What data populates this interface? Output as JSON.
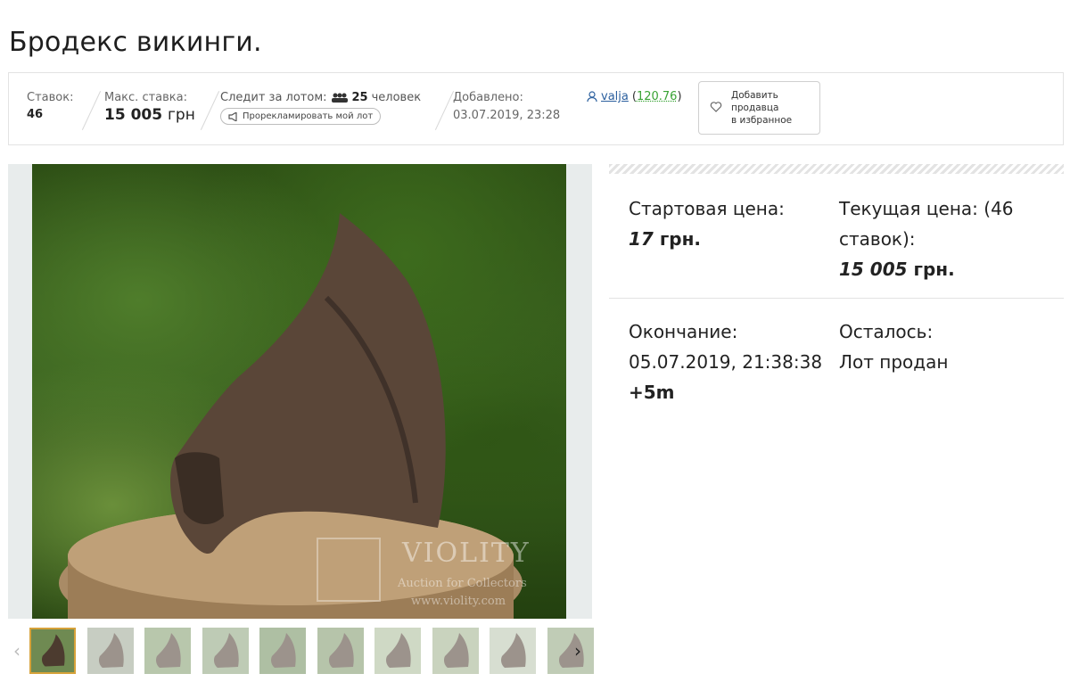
{
  "title": "Бродекс викинги.",
  "stats": {
    "bids_label": "Ставок:",
    "bids_value": "46",
    "max_bid_label": "Макс. ставка:",
    "max_bid_value": "15 005",
    "max_bid_unit": "грн",
    "watch_label": "Следит за лотом:",
    "watch_count": "25",
    "watch_unit": "человек",
    "promo_button": "Прорекламировать мой лот",
    "added_label": "Добавлено:",
    "added_value": "03.07.2019, 23:28"
  },
  "seller": {
    "name": "valja",
    "rating_open": "(",
    "rating": "120.76",
    "rating_close": ")"
  },
  "favorite_button": {
    "line1": "Добавить",
    "line2": "продавца",
    "line3": "в избранное"
  },
  "price": {
    "start_label": "Стартовая цена:",
    "start_value": "17",
    "start_unit": "грн.",
    "current_label_1": "Текущая цена: (46",
    "current_label_2": "ставок):",
    "current_value": "15 005",
    "current_unit": "грн."
  },
  "ending": {
    "end_label": "Окончание:",
    "end_value": "05.07.2019, 21:38:38",
    "end_extension": "+5m",
    "left_label": "Осталось:",
    "left_value": "Лот продан"
  },
  "watermark": {
    "brand": "VIOLITY",
    "tagline": "Auction for Collectors",
    "site": "www.violity.com"
  },
  "gallery": {
    "thumb_count": 10,
    "active_index": 0,
    "prev_icon": "chevron-left-icon",
    "next_icon": "chevron-right-icon"
  },
  "colors": {
    "link": "#2b5f9e",
    "rating": "#3aa335",
    "active_thumb_border": "#d6a23a"
  }
}
